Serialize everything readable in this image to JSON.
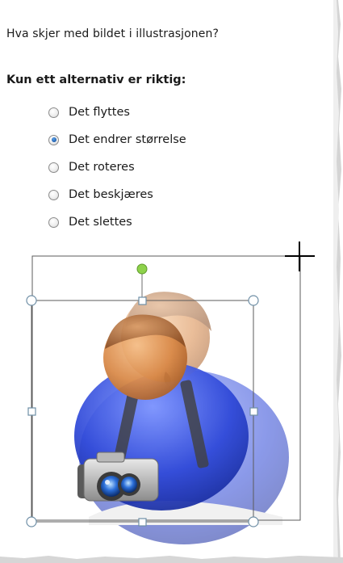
{
  "question": "Hva skjer med bildet i illustrasjonen?",
  "instruction": "Kun ett alternativ er riktig:",
  "options": [
    {
      "label": "Det flyttes",
      "checked": false
    },
    {
      "label": "Det endrer størrelse",
      "checked": true
    },
    {
      "label": "Det roteres",
      "checked": false
    },
    {
      "label": "Det beskjæres",
      "checked": false
    },
    {
      "label": "Det slettes",
      "checked": false
    }
  ],
  "colors": {
    "selection_border": "#5b5b5b",
    "handle_fill": "#ffffff",
    "handle_stroke": "#6f8fa6",
    "rotation_handle": "#8ed24b",
    "radio_selected": "#1f5fae"
  },
  "icons": [
    "person-with-camera-icon",
    "crosshair-cursor-icon",
    "rotation-handle-icon",
    "resize-handle-icon"
  ]
}
